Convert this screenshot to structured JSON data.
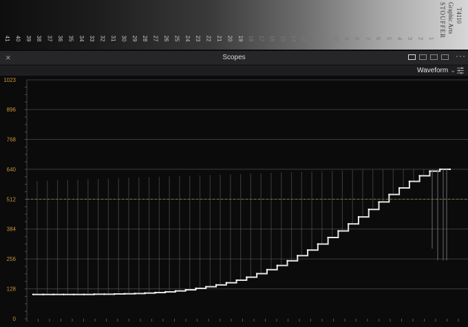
{
  "reference_chart": {
    "brand_lines": [
      "STOUFFER",
      "Graphic Arts",
      "T4110"
    ],
    "step_numbers": [
      "41",
      "40",
      "39",
      "38",
      "37",
      "36",
      "35",
      "34",
      "33",
      "32",
      "31",
      "30",
      "29",
      "28",
      "27",
      "26",
      "25",
      "24",
      "23",
      "22",
      "21",
      "20",
      "19",
      "18",
      "17",
      "16",
      "15",
      "14",
      "13",
      "12",
      "11",
      "10",
      "9",
      "8",
      "7",
      "6",
      "5",
      "4",
      "3",
      "2",
      "1"
    ]
  },
  "panel": {
    "title": "Scopes",
    "close_icon": "close-icon",
    "view_mode": "Waveform",
    "layout_buttons": [
      "single-layout-icon",
      "dual-layout-icon",
      "quad-layout-icon",
      "grid-layout-icon"
    ],
    "more_icon": "more-options-icon",
    "settings_icon": "sliders-icon"
  },
  "chart_data": {
    "type": "line",
    "title": "",
    "xlabel": "",
    "ylabel": "",
    "ylim": [
      0,
      1023
    ],
    "y_ticks": [
      "1023",
      "896",
      "768",
      "640",
      "512",
      "384",
      "256",
      "128",
      "0"
    ],
    "reference_line": 512,
    "series": [
      {
        "x": [
          0,
          3.5,
          7,
          10.5,
          14,
          17.5,
          21,
          24.5,
          28,
          31.5,
          35,
          38.5,
          42,
          45.5,
          49,
          52.5,
          56,
          59.5,
          63,
          66.5,
          70,
          73.5,
          77,
          80.5,
          84,
          87.5,
          91,
          94.5,
          98,
          101.5,
          105,
          108.5,
          112,
          115.5,
          119,
          122.5,
          126,
          129.5,
          133,
          136.5,
          140,
          143.5
        ],
        "values": [
          104,
          104,
          104,
          104,
          104,
          104,
          105,
          105,
          106,
          107,
          108,
          110,
          112,
          115,
          119,
          124,
          130,
          137,
          145,
          154,
          165,
          178,
          193,
          210,
          228,
          248,
          270,
          294,
          320,
          348,
          376,
          406,
          436,
          468,
          500,
          532,
          560,
          588,
          612,
          632,
          640,
          640
        ]
      }
    ],
    "grid": true,
    "colors": {
      "trace": "#e6e6e6",
      "grid": "#3c3c3c",
      "axis_labels": "#c9963a"
    }
  }
}
